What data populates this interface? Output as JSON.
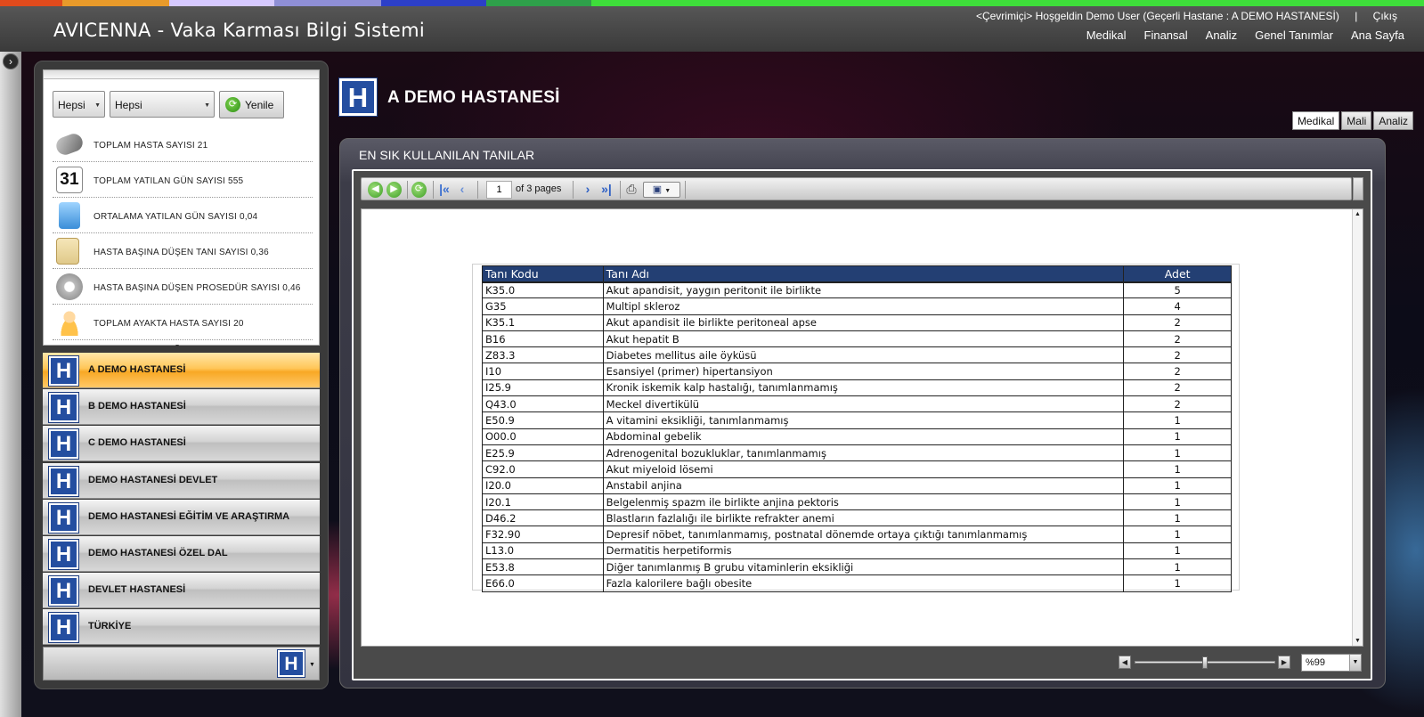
{
  "header": {
    "app_title": "AVICENNA - Vaka Karması Bilgi Sistemi",
    "welcome_text": "<Çevrimiçi> Hoşgeldin Demo User (Geçerli Hastane : A DEMO HASTANESİ)",
    "separator": "|",
    "logout": "Çıkış",
    "nav": [
      "Medikal",
      "Finansal",
      "Analiz",
      "Genel Tanımlar",
      "Ana Sayfa"
    ],
    "strip_colors": [
      "#e04a1c",
      "#e89a2a",
      "#d6c9ff",
      "#8f8fd6",
      "#2c3fc8",
      "#2ea04a",
      "#3ede3a"
    ]
  },
  "filters": {
    "dropdown1": "Hepsi",
    "dropdown2": "Hepsi",
    "refresh_label": "Yenile"
  },
  "stats": [
    {
      "icon": "stethoscope-icon",
      "text": "TOPLAM HASTA SAYISI 21"
    },
    {
      "icon": "calendar-icon",
      "text": "TOPLAM YATILAN GÜN SAYISI  555",
      "icon_text": "31"
    },
    {
      "icon": "calculator-icon",
      "text": "ORTALAMA YATILAN GÜN SAYISI 0,04"
    },
    {
      "icon": "notepad-icon",
      "text": "HASTA BAŞINA DÜŞEN TANI SAYISI 0,36"
    },
    {
      "icon": "gear-icon",
      "text": "HASTA BAŞINA DÜŞEN PROSEDÜR SAYISI 0,46"
    },
    {
      "icon": "user-icon",
      "text": "TOPLAM AYAKTA HASTA SAYISI  20"
    }
  ],
  "hospitals": [
    {
      "name": "A DEMO HASTANESİ",
      "active": true
    },
    {
      "name": "B DEMO HASTANESİ",
      "active": false
    },
    {
      "name": "C DEMO HASTANESİ",
      "active": false
    },
    {
      "name": "DEMO HASTANESİ DEVLET",
      "active": false
    },
    {
      "name": "DEMO HASTANESİ EĞİTİM VE ARAŞTIRMA",
      "active": false
    },
    {
      "name": "DEMO HASTANESİ ÖZEL DAL",
      "active": false
    },
    {
      "name": "DEVLET HASTANESİ",
      "active": false
    },
    {
      "name": "TÜRKİYE",
      "active": false
    }
  ],
  "hospital_icon_letter": "H",
  "main": {
    "title": "A DEMO HASTANESİ",
    "tabs": [
      "Medikal",
      "Mali",
      "Analiz"
    ],
    "active_tab": "Medikal",
    "section_title": "EN SIK KULLANILAN TANILAR"
  },
  "report": {
    "page_current": "1",
    "page_total_text": "of 3 pages",
    "zoom": "%99",
    "zoom_level": 0.5,
    "columns": [
      "Tanı Kodu",
      "Tanı Adı",
      "Adet"
    ],
    "rows": [
      [
        "K35.0",
        "Akut apandisit, yaygın peritonit ile birlikte",
        "5"
      ],
      [
        "G35",
        "Multipl skleroz",
        "4"
      ],
      [
        "K35.1",
        "Akut apandisit ile birlikte peritoneal apse",
        "2"
      ],
      [
        "B16",
        "Akut hepatit B",
        "2"
      ],
      [
        "Z83.3",
        "Diabetes mellitus aile öyküsü",
        "2"
      ],
      [
        "I10",
        "Esansiyel (primer) hipertansiyon",
        "2"
      ],
      [
        "I25.9",
        "Kronik iskemik kalp hastalığı, tanımlanmamış",
        "2"
      ],
      [
        "Q43.0",
        "Meckel divertikülü",
        "2"
      ],
      [
        "E50.9",
        "A vitamini eksikliği, tanımlanmamış",
        "1"
      ],
      [
        "O00.0",
        "Abdominal gebelik",
        "1"
      ],
      [
        "E25.9",
        "Adrenogenital bozukluklar, tanımlanmamış",
        "1"
      ],
      [
        "C92.0",
        "Akut miyeloid lösemi",
        "1"
      ],
      [
        "I20.0",
        "Anstabil anjina",
        "1"
      ],
      [
        "I20.1",
        "Belgelenmiş spazm ile birlikte anjina pektoris",
        "1"
      ],
      [
        "D46.2",
        "Blastların fazlalığı ile birlikte refrakter anemi",
        "1"
      ],
      [
        "F32.90",
        "Depresif nöbet, tanımlanmamış, postnatal dönemde ortaya çıktığı tanımlanmamış",
        "1"
      ],
      [
        "L13.0",
        "Dermatitis herpetiformis",
        "1"
      ],
      [
        "E53.8",
        "Diğer tanımlanmış B grubu vitaminlerin eksikliği",
        "1"
      ],
      [
        "E66.0",
        "Fazla kalorilere bağlı obesite",
        "1"
      ]
    ]
  }
}
